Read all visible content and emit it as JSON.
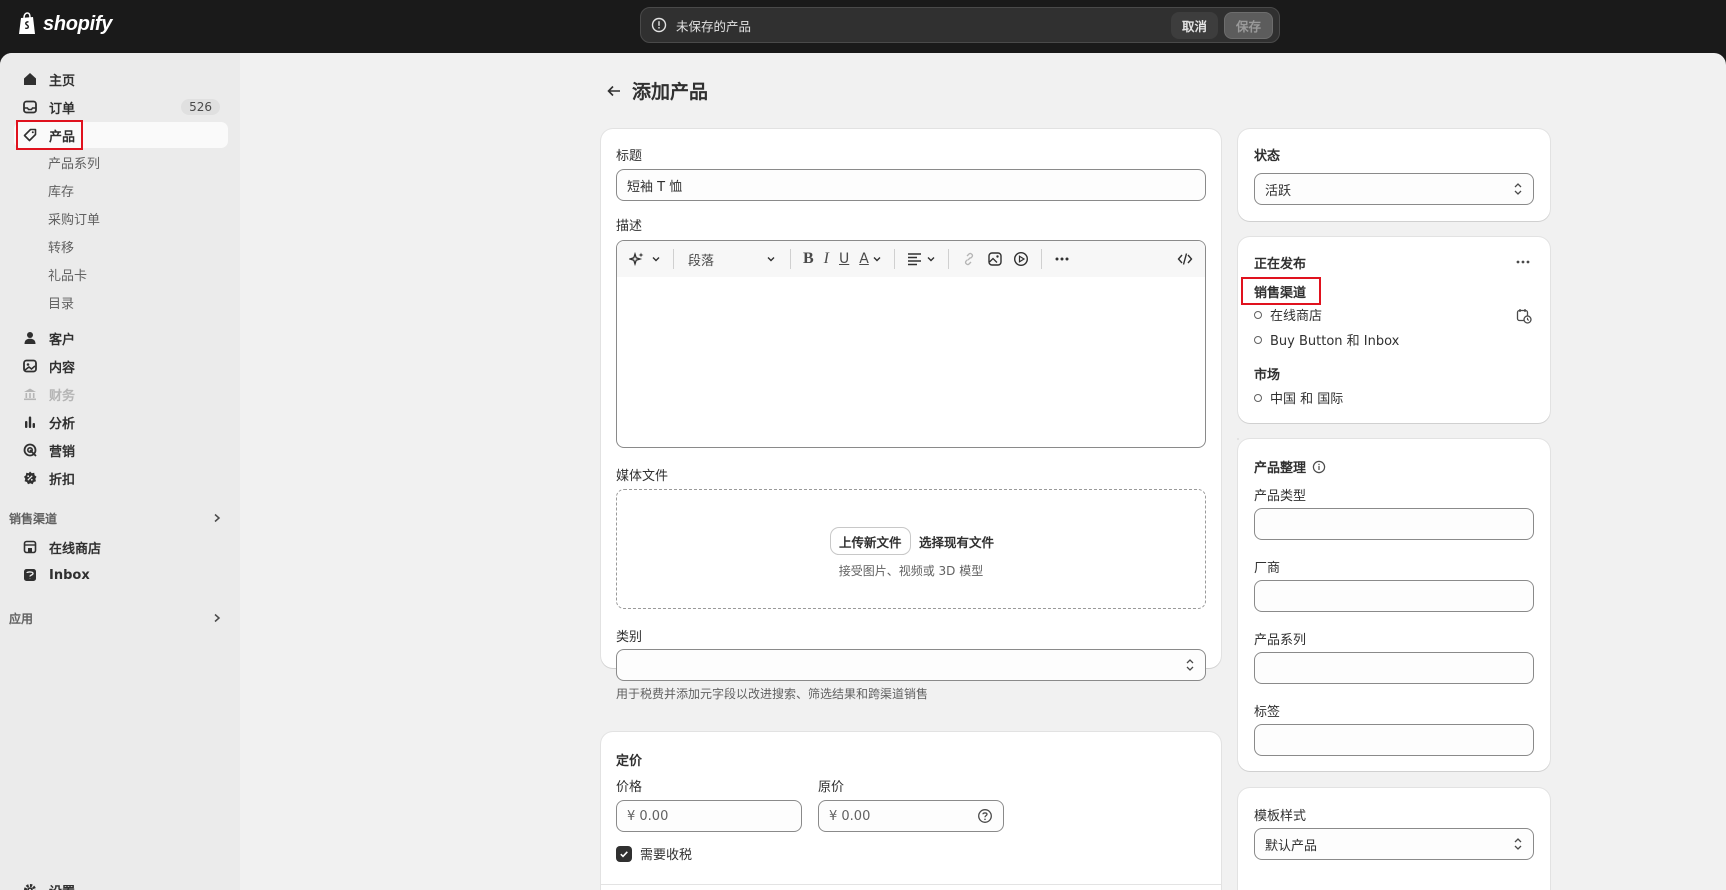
{
  "topbar": {
    "logo_text": "shopify",
    "unsaved_message": "未保存的产品",
    "cancel_label": "取消",
    "save_label": "保存"
  },
  "sidebar": {
    "home": "主页",
    "orders": "订单",
    "orders_count": "526",
    "products": "产品",
    "collections": "产品系列",
    "inventory": "库存",
    "purchase_orders": "采购订单",
    "transfers": "转移",
    "gift_cards": "礼品卡",
    "catalogs": "目录",
    "customers": "客户",
    "content": "内容",
    "finance": "财务",
    "analytics": "分析",
    "marketing": "营销",
    "discounts": "折扣",
    "sales_channels_header": "销售渠道",
    "online_store": "在线商店",
    "inbox": "Inbox",
    "apps_header": "应用",
    "settings": "设置"
  },
  "page": {
    "title": "添加产品"
  },
  "product_card": {
    "title_label": "标题",
    "title_value": "短袖 T 恤",
    "description_label": "描述",
    "paragraph_select": "段落",
    "media_label": "媒体文件",
    "upload_new": "上传新文件",
    "select_existing": "选择现有文件",
    "media_hint": "接受图片、视频或 3D 模型",
    "category_label": "类别",
    "category_value": "",
    "category_hint": "用于税费并添加元字段以改进搜索、筛选结果和跨渠道销售"
  },
  "pricing_card": {
    "header": "定价",
    "price_label": "价格",
    "price_value": "¥ 0.00",
    "compare_label": "原价",
    "compare_value": "¥ 0.00",
    "charge_tax_label": "需要收税"
  },
  "status_card": {
    "header": "状态",
    "status_value": "活跃"
  },
  "publishing_card": {
    "header": "正在发布",
    "sales_channels_label": "销售渠道",
    "channels": [
      "在线商店",
      "Buy Button 和 Inbox"
    ],
    "markets_label": "市场",
    "markets": [
      "中国 和 国际"
    ]
  },
  "organization_card": {
    "header": "产品整理",
    "type_label": "产品类型",
    "vendor_label": "厂商",
    "collections_label": "产品系列",
    "tags_label": "标签"
  },
  "template_card": {
    "header": "模板样式",
    "value": "默认产品"
  },
  "colors": {
    "highlight": "#e0121e",
    "topbar": "#1a1a1a"
  }
}
